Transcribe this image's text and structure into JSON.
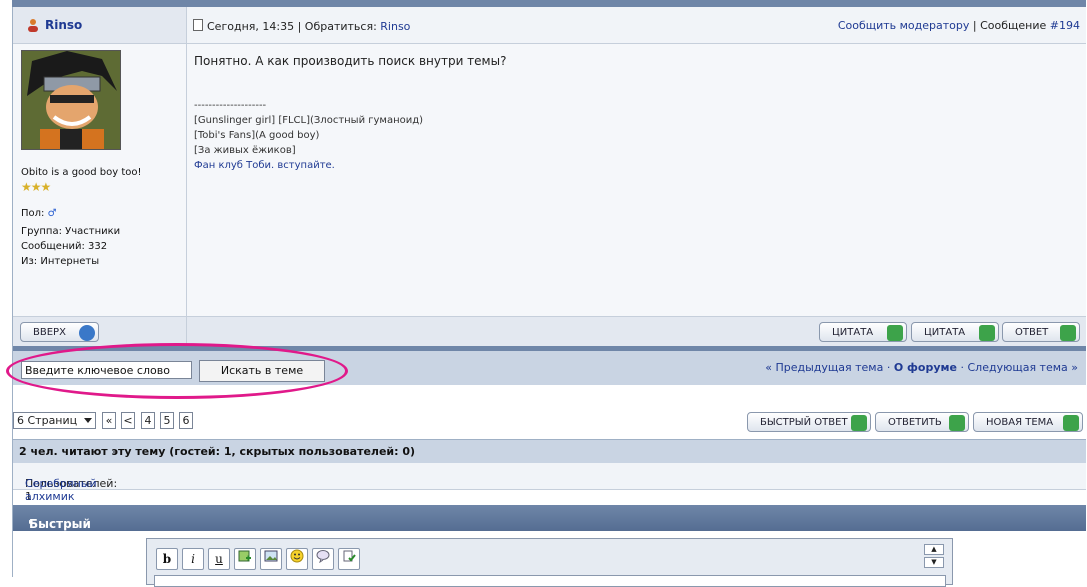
{
  "post": {
    "author": "Rinso",
    "date": "Сегодня, 14:35",
    "address_label": "Обратиться:",
    "address_name": "Rinso",
    "report_label": "Сообщить модератору",
    "message_label": "Сообщение",
    "message_number": "#194",
    "text": "Понятно. А как производить поиск внутри темы?",
    "signature": {
      "divider": "--------------------",
      "line1": "[Gunslinger girl] [FLCL](Злостный гуманоид)",
      "line2": "[Tobi's Fans](A good boy)",
      "line3": "[За живых ёжиков]",
      "line4": "Фан клуб Тоби. вступайте."
    }
  },
  "profile": {
    "motto": "Obito is a good boy too!",
    "stars": "★★★",
    "gender_label": "Пол:",
    "gender_symbol": "♂",
    "group": "Группа: Участники",
    "posts": "Сообщений: 332",
    "from": "Из: Интернеты"
  },
  "buttons": {
    "up": "ВВЕРХ",
    "quote1": "ЦИТАТА",
    "quote2": "ЦИТАТА",
    "reply": "ОТВЕТ",
    "fast_reply": "БЫСТРЫЙ ОТВЕТ",
    "answer": "ОТВЕТИТЬ",
    "new_topic": "НОВАЯ ТЕМА"
  },
  "search": {
    "value": "Введите ключевое слово",
    "button": "Искать в теме"
  },
  "topic_nav": {
    "prev": "« Предыдущая тема",
    "forum": "О форуме",
    "next": "Следующая тема »",
    "sep": "·"
  },
  "pager": {
    "select": "6 Страниц",
    "first": "«",
    "prev": "<",
    "pages": [
      "4",
      "5",
      "6"
    ]
  },
  "readers": {
    "title": "2 чел. читают эту тему (гостей: 1, скрытых пользователей: 0)",
    "users_label": "Пользователей: 1",
    "user": "Серебряный алхимик"
  },
  "quick_reply": {
    "title": "Быстрый ответ",
    "toolbar": [
      "b",
      "i",
      "u"
    ]
  },
  "colors": {
    "accent": "#1f3a93",
    "header_blue": "#6f86a8",
    "highlight_oval": "#e0198a"
  }
}
